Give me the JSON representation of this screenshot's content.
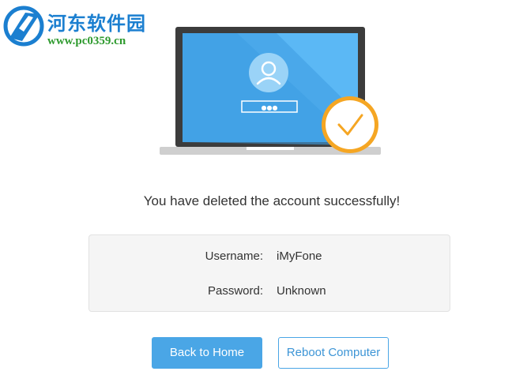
{
  "watermark": {
    "site_name": "河东软件园",
    "site_url": "www.pc0359.cn"
  },
  "illustration": {
    "password_mask": "●●●",
    "icons": [
      "user-avatar-icon",
      "checkmark-icon"
    ]
  },
  "message": "You have deleted the account successfully!",
  "account": {
    "username_label": "Username:",
    "username_value": "iMyFone",
    "password_label": "Password:",
    "password_value": "Unknown"
  },
  "buttons": {
    "back_home": "Back to Home",
    "reboot": "Reboot Computer"
  },
  "colors": {
    "accent": "#4aa6e6",
    "check_orange": "#f5a623",
    "screen_blue": "#5bb8f5"
  }
}
